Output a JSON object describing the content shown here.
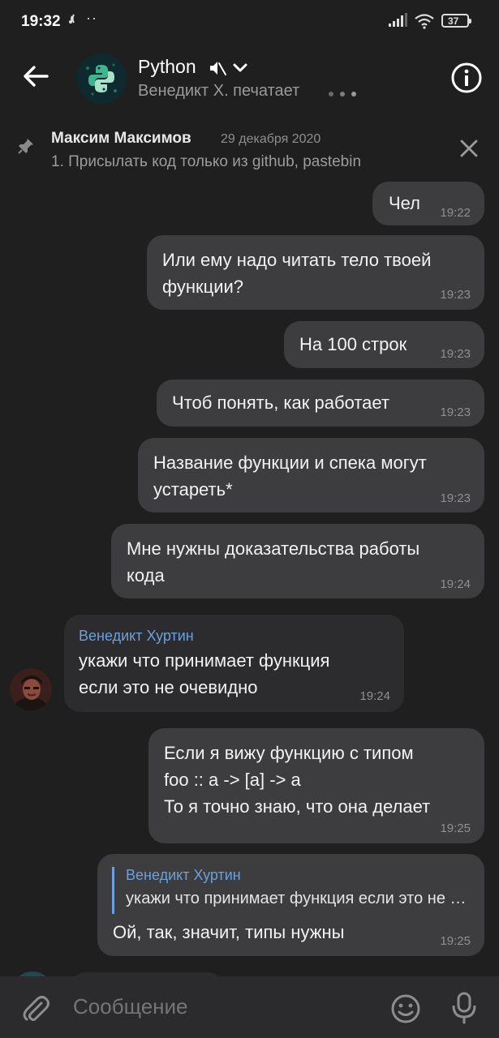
{
  "status": {
    "time": "19:32",
    "battery": "37"
  },
  "header": {
    "title": "Python",
    "subtitle": "Венедикт Х. печатает"
  },
  "pinned": {
    "author": "Максим Максимов",
    "date": "29 декабря 2020",
    "text": "1. Присылать код только из  github, pastebin"
  },
  "messages": [
    {
      "text": "Чел",
      "time": "19:22"
    },
    {
      "lines": [
        "Или ему надо читать тело твоей",
        "функции?"
      ],
      "time": "19:23"
    },
    {
      "text": "На 100 строк",
      "time": "19:23"
    },
    {
      "text": "Чтоб понять, как работает",
      "time": "19:23"
    },
    {
      "lines": [
        "Название функции и спека могут",
        "устареть*"
      ],
      "time": "19:23"
    },
    {
      "lines": [
        "Мне нужны доказательства работы",
        "кода"
      ],
      "time": "19:24"
    },
    {
      "author": "Венедикт Хуртин",
      "lines": [
        "укажи что принимает функция",
        "если это не очевидно"
      ],
      "time": "19:24"
    },
    {
      "lines": [
        "Если я вижу функцию с типом",
        "foo :: a -> [a] -> a",
        "То я точно знаю, что она делает"
      ],
      "time": "19:25"
    },
    {
      "reply_author": "Венедикт Хуртин",
      "reply_text": "укажи что принимает функция если это не очевидно",
      "text": "Ой, так, значит, типы нужны",
      "time": "19:25"
    }
  ],
  "composer": {
    "placeholder": "Сообщение"
  },
  "colors": {
    "background": "#1f1f1f",
    "outgoing_bubble": "#3d3d3f",
    "incoming_bubble": "#2c2c2e",
    "accent_name": "#6aa0dd"
  },
  "icons": {
    "back": "arrow-left-icon",
    "mute": "speaker-muted-icon",
    "dropdown": "chevron-down-icon",
    "info": "info-icon",
    "pin": "pin-icon",
    "close": "close-icon",
    "attach": "paperclip-icon",
    "emoji": "smiley-icon",
    "mic": "microphone-icon"
  }
}
